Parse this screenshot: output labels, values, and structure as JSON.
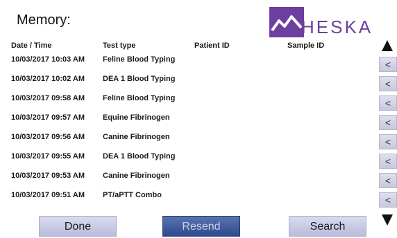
{
  "screen": {
    "title": "Memory:"
  },
  "logo": {
    "text": "HESKA",
    "brand_color": "#6d3f9f"
  },
  "table": {
    "columns": [
      "Date / Time",
      "Test type",
      "Patient ID",
      "Sample ID"
    ],
    "rows": [
      {
        "datetime": "10/03/2017 10:03 AM",
        "test_type": "Feline Blood Typing",
        "patient_id": "",
        "sample_id": ""
      },
      {
        "datetime": "10/03/2017 10:02 AM",
        "test_type": "DEA 1 Blood Typing",
        "patient_id": "",
        "sample_id": ""
      },
      {
        "datetime": "10/03/2017 09:58 AM",
        "test_type": "Feline Blood Typing",
        "patient_id": "",
        "sample_id": ""
      },
      {
        "datetime": "10/03/2017 09:57 AM",
        "test_type": "Equine Fibrinogen",
        "patient_id": "",
        "sample_id": ""
      },
      {
        "datetime": "10/03/2017 09:56 AM",
        "test_type": "Canine Fibrinogen",
        "patient_id": "",
        "sample_id": ""
      },
      {
        "datetime": "10/03/2017 09:55 AM",
        "test_type": "DEA 1 Blood Typing",
        "patient_id": "",
        "sample_id": ""
      },
      {
        "datetime": "10/03/2017 09:53 AM",
        "test_type": "Canine Fibrinogen",
        "patient_id": "",
        "sample_id": ""
      },
      {
        "datetime": "10/03/2017 09:51 AM",
        "test_type": "PT/aPTT Combo",
        "patient_id": "",
        "sample_id": ""
      }
    ]
  },
  "row_button_label": "<",
  "scroll": {
    "up_icon": "triangle-up-icon",
    "down_icon": "triangle-down-icon"
  },
  "buttons": {
    "done": "Done",
    "resend": "Resend",
    "search": "Search"
  }
}
